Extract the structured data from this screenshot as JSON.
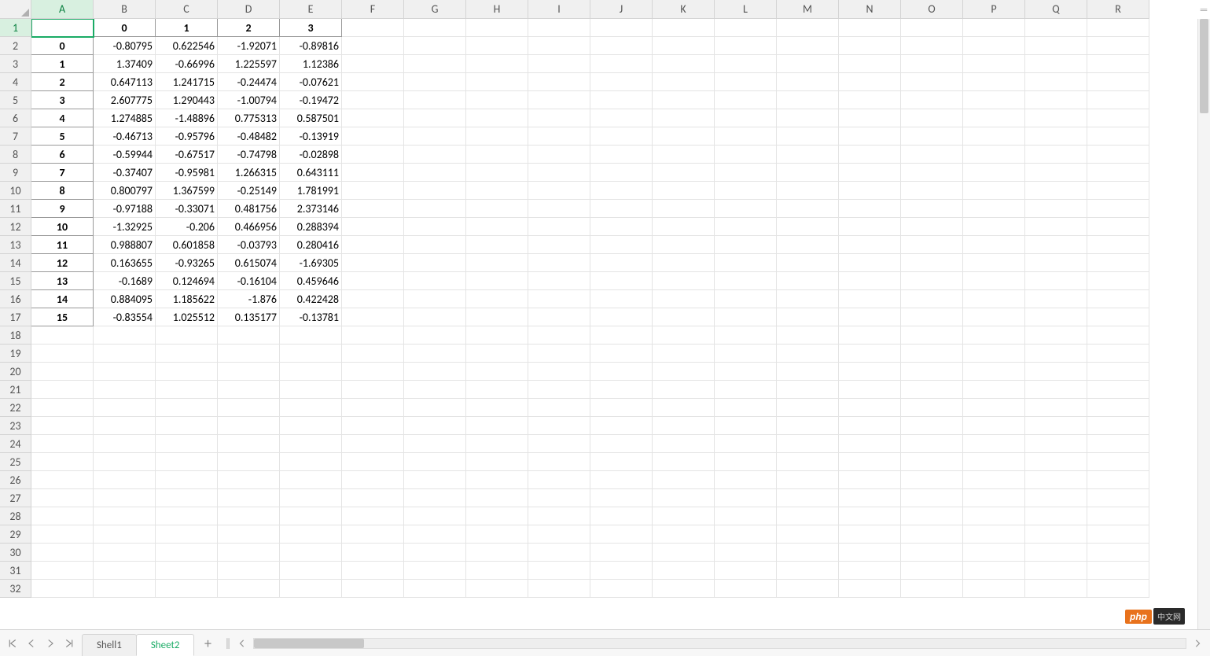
{
  "columns": [
    "A",
    "B",
    "C",
    "D",
    "E",
    "F",
    "G",
    "H",
    "I",
    "J",
    "K",
    "L",
    "M",
    "N",
    "O",
    "P",
    "Q",
    "R"
  ],
  "row_count": 32,
  "active_cell": {
    "row": 1,
    "col": "A"
  },
  "tabs": [
    {
      "label": "Shell1",
      "active": false
    },
    {
      "label": "Sheet2",
      "active": true
    }
  ],
  "header_row": {
    "A": "",
    "B": "0",
    "C": "1",
    "D": "2",
    "E": "3"
  },
  "data_rows": [
    {
      "A": "0",
      "B": "-0.80795",
      "C": "0.622546",
      "D": "-1.92071",
      "E": "-0.89816"
    },
    {
      "A": "1",
      "B": "1.37409",
      "C": "-0.66996",
      "D": "1.225597",
      "E": "1.12386"
    },
    {
      "A": "2",
      "B": "0.647113",
      "C": "1.241715",
      "D": "-0.24474",
      "E": "-0.07621"
    },
    {
      "A": "3",
      "B": "2.607775",
      "C": "1.290443",
      "D": "-1.00794",
      "E": "-0.19472"
    },
    {
      "A": "4",
      "B": "1.274885",
      "C": "-1.48896",
      "D": "0.775313",
      "E": "0.587501"
    },
    {
      "A": "5",
      "B": "-0.46713",
      "C": "-0.95796",
      "D": "-0.48482",
      "E": "-0.13919"
    },
    {
      "A": "6",
      "B": "-0.59944",
      "C": "-0.67517",
      "D": "-0.74798",
      "E": "-0.02898"
    },
    {
      "A": "7",
      "B": "-0.37407",
      "C": "-0.95981",
      "D": "1.266315",
      "E": "0.643111"
    },
    {
      "A": "8",
      "B": "0.800797",
      "C": "1.367599",
      "D": "-0.25149",
      "E": "1.781991"
    },
    {
      "A": "9",
      "B": "-0.97188",
      "C": "-0.33071",
      "D": "0.481756",
      "E": "2.373146"
    },
    {
      "A": "10",
      "B": "-1.32925",
      "C": "-0.206",
      "D": "0.466956",
      "E": "0.288394"
    },
    {
      "A": "11",
      "B": "0.988807",
      "C": "0.601858",
      "D": "-0.03793",
      "E": "0.280416"
    },
    {
      "A": "12",
      "B": "0.163655",
      "C": "-0.93265",
      "D": "0.615074",
      "E": "-1.69305"
    },
    {
      "A": "13",
      "B": "-0.1689",
      "C": "0.124694",
      "D": "-0.16104",
      "E": "0.459646"
    },
    {
      "A": "14",
      "B": "0.884095",
      "C": "1.185622",
      "D": "-1.876",
      "E": "0.422428"
    },
    {
      "A": "15",
      "B": "-0.83554",
      "C": "1.025512",
      "D": "0.135177",
      "E": "-0.13781"
    }
  ],
  "watermark": {
    "php": "php",
    "cn": "中文网"
  }
}
